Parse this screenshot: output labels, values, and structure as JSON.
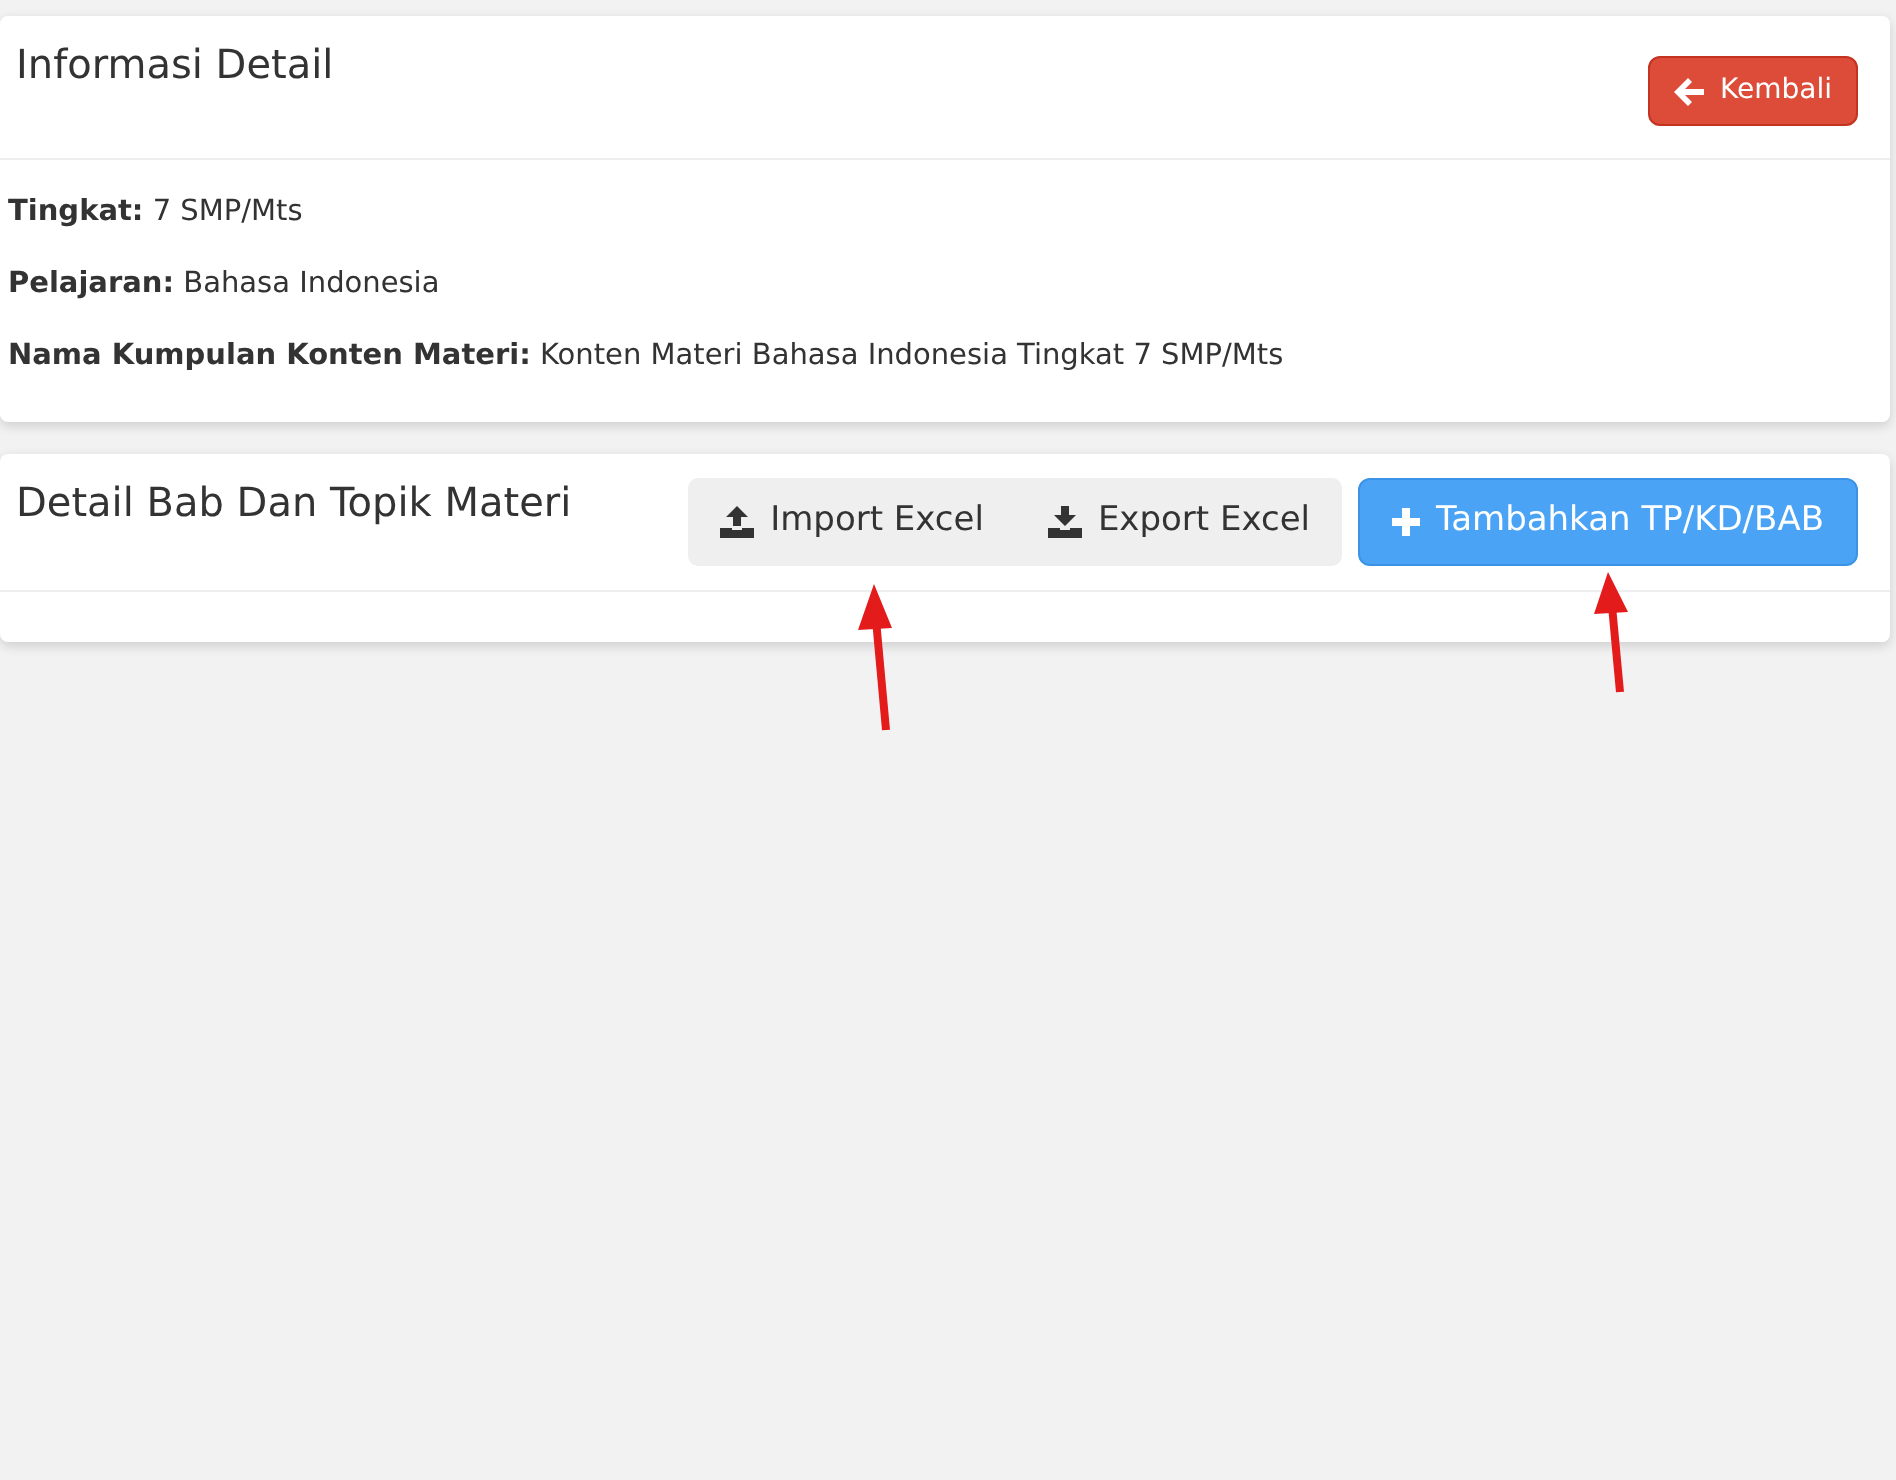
{
  "info_card": {
    "title": "Informasi Detail",
    "back_button": "Kembali",
    "fields": [
      {
        "label": "Tingkat:",
        "value": "7 SMP/Mts"
      },
      {
        "label": "Pelajaran:",
        "value": "Bahasa Indonesia"
      },
      {
        "label": "Nama Kumpulan Konten Materi:",
        "value": "Konten Materi Bahasa Indonesia Tingkat 7 SMP/Mts"
      }
    ]
  },
  "detail_card": {
    "title": "Detail Bab Dan Topik Materi",
    "buttons": [
      {
        "kind": "import",
        "label": "Import Excel"
      },
      {
        "kind": "export",
        "label": "Export Excel"
      },
      {
        "kind": "add",
        "label": "Tambahkan TP/KD/BAB"
      }
    ]
  }
}
